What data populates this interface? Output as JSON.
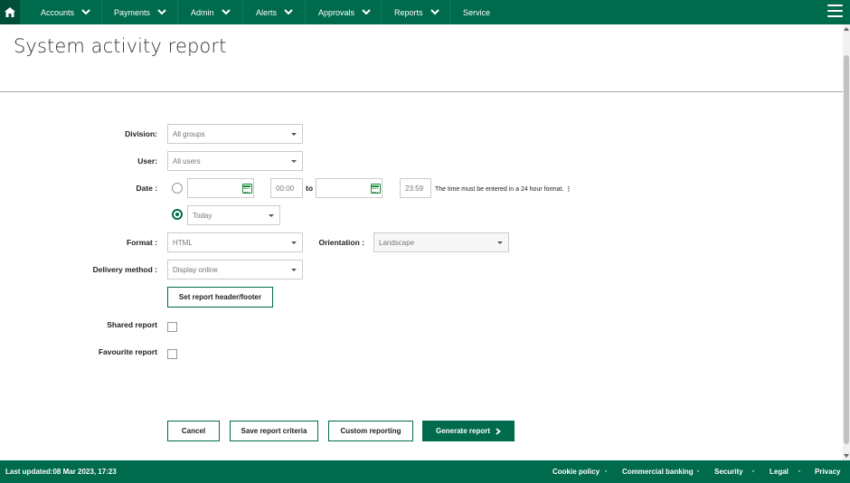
{
  "nav": {
    "items": [
      {
        "label": "Accounts"
      },
      {
        "label": "Payments"
      },
      {
        "label": "Admin"
      },
      {
        "label": "Alerts"
      },
      {
        "label": "Approvals"
      },
      {
        "label": "Reports"
      },
      {
        "label": "Service"
      }
    ]
  },
  "page": {
    "title": "System activity report"
  },
  "form": {
    "division_label": "Division:",
    "division_value": "All groups",
    "user_label": "User:",
    "user_value": "All users",
    "date_label": "Date :",
    "time_from": "00:00",
    "to_label": "to",
    "time_to": "23:59",
    "time_hint": "The time must be entered in a 24 hour format.",
    "date_preset": "Today",
    "format_label": "Format :",
    "format_value": "HTML",
    "orientation_label": "Orientation :",
    "orientation_value": "Landscape",
    "delivery_label": "Delivery method :",
    "delivery_value": "Display online",
    "header_footer_button": "Set report header/footer",
    "shared_label": "Shared report",
    "favourite_label": "Favourite report"
  },
  "actions": {
    "cancel": "Cancel",
    "save": "Save report criteria",
    "custom": "Custom reporting",
    "generate": "Generate report"
  },
  "footer": {
    "last_updated": "Last updated:08 Mar 2023, 17:23",
    "links": [
      "Cookie policy",
      "Commercial banking",
      "Security",
      "Legal",
      "Privacy"
    ]
  },
  "colors": {
    "brand_green": "#006a4d"
  }
}
